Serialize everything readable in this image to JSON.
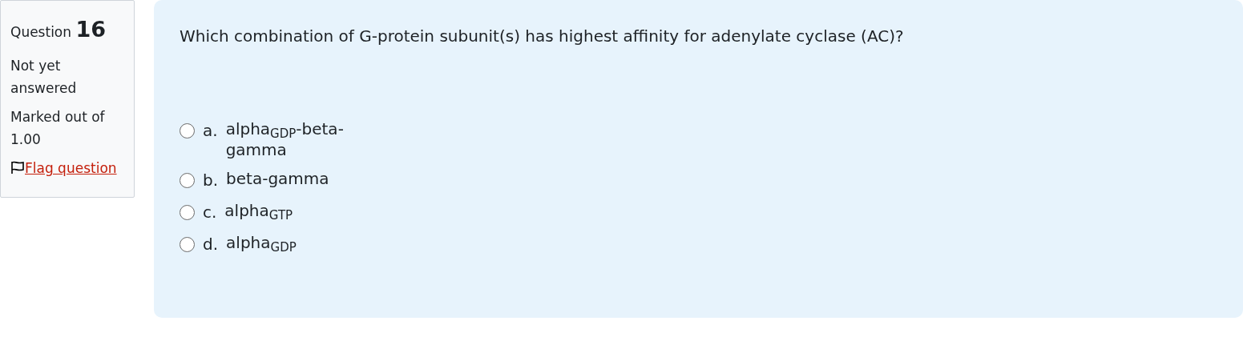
{
  "info": {
    "label": "Question",
    "number": "16",
    "state": "Not yet answered",
    "grade": "Marked out of 1.00",
    "flag": {
      "label": "Flag question",
      "flagged": false
    }
  },
  "question": {
    "text": "Which combination of G-protein subunit(s) has highest affinity for adenylate cyclase (AC)?",
    "options": [
      {
        "letter": "a.",
        "text": "alpha$_{GDP}$-beta-gamma",
        "selected": false
      },
      {
        "letter": "b.",
        "text": "beta-gamma",
        "selected": false
      },
      {
        "letter": "c.",
        "text": "alpha$_{GTP}$",
        "selected": false
      },
      {
        "letter": "d.",
        "text": "alpha$_{GDP}$",
        "selected": false
      }
    ]
  }
}
